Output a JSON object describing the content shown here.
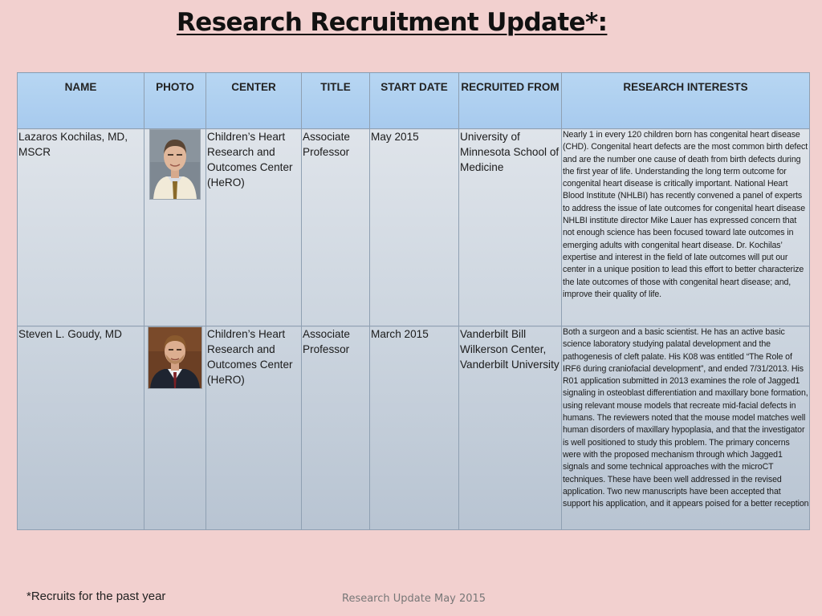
{
  "slide": {
    "title": "Research Recruitment Update*:",
    "footnote": "*Recruits for the past year",
    "footer": "Research Update May 2015"
  },
  "table": {
    "headers": [
      "NAME",
      "PHOTO",
      "CENTER",
      "TITLE",
      "START DATE",
      "RECRUITED FROM",
      "RESEARCH INTERESTS"
    ],
    "rows": [
      {
        "name": "Lazaros Kochilas, MD, MSCR",
        "photo_icon": "headshot-photo",
        "center": "Children’s Heart Research and Outcomes Center (HeRO)",
        "title": "Associate Professor",
        "start_date": "May 2015",
        "recruited_from": "University of Minnesota School of Medicine",
        "research_interests": "Nearly 1 in every 120 children born has congenital heart disease (CHD). Congenital heart defects are the most common birth defect and are the number one cause of death from birth defects during the first year of life. Understanding the long term outcome for congenital heart disease is critically important. National Heart Blood Institute (NHLBI) has recently convened a panel of experts to address the issue of late outcomes for congenital heart disease NHLBI institute director Mike Lauer has expressed concern that not enough science has been focused toward late outcomes in emerging adults with congenital heart disease. Dr. Kochilas’ expertise and interest in the field of late outcomes will put our center in a unique position to lead this effort to better characterize the late outcomes of those with congenital heart disease; and, improve their quality of life."
      },
      {
        "name": "Steven L. Goudy, MD",
        "photo_icon": "headshot-photo",
        "center": "Children’s Heart Research and Outcomes Center (HeRO)",
        "title": "Associate Professor",
        "start_date": "March 2015",
        "recruited_from": "Vanderbilt Bill Wilkerson Center, Vanderbilt University",
        "research_interests": "Both a surgeon and a basic scientist. He has an active basic science laboratory studying palatal development and the pathogenesis of cleft palate. His K08 was entitled “The Role of IRF6 during craniofacial development”, and ended 7/31/2013. His R01 application submitted in 2013 examines the role of Jagged1 signaling in osteoblast differentiation and maxillary bone formation, using relevant mouse models that recreate mid-facial defects in humans. The reviewers noted that the mouse model matches well human disorders of maxillary hypoplasia, and that the investigator is well positioned to study this problem. The primary concerns were with the proposed mechanism through which Jagged1 signals and some technical approaches with the microCT techniques. These have been well addressed in the revised application. Two new manuscripts have been accepted that support his application, and it appears poised for a better reception"
      }
    ]
  }
}
